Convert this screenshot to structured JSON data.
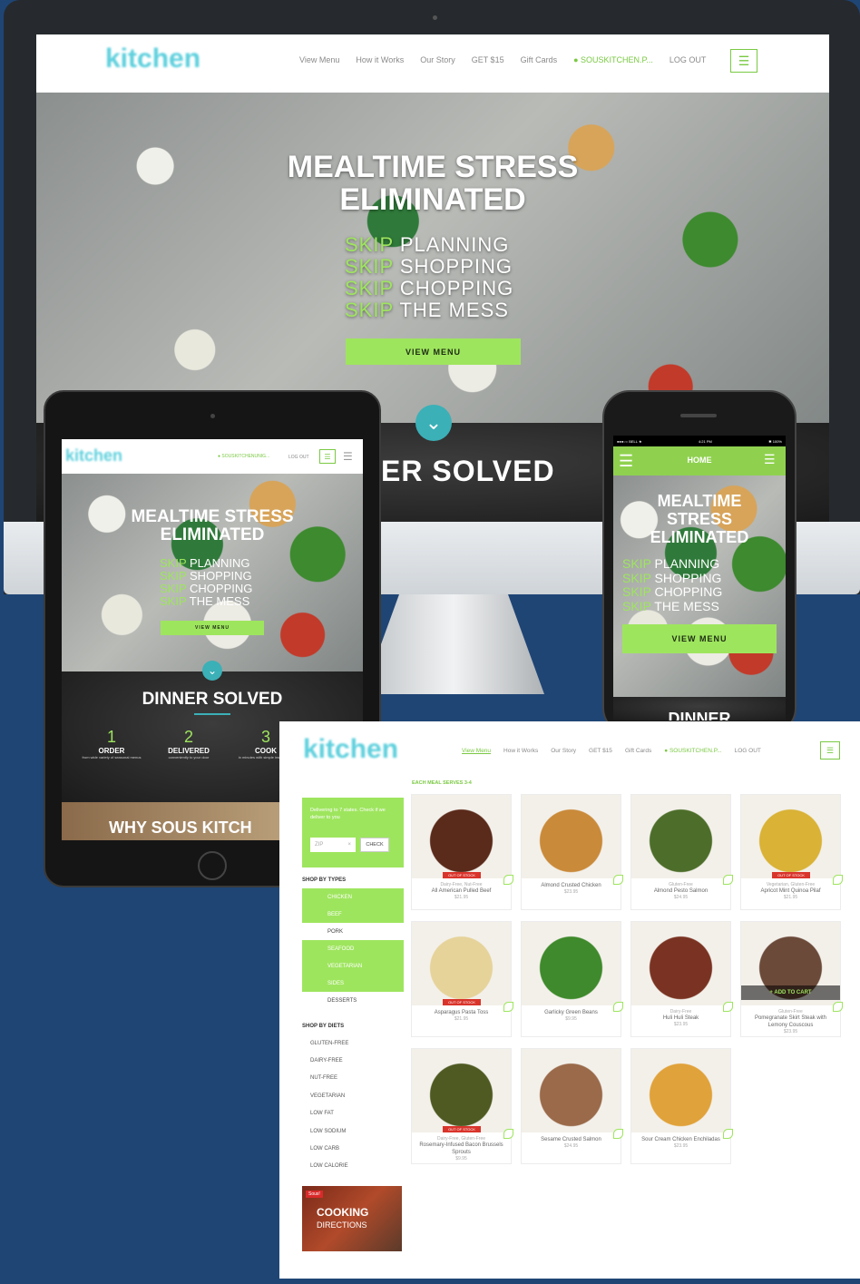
{
  "desktop": {
    "nav": [
      "View Menu",
      "How it Works",
      "Our Story",
      "GET $15",
      "Gift Cards"
    ],
    "user": "SOUSKITCHEN.P...",
    "logout": "LOG OUT",
    "hero": {
      "title1": "MEALTIME STRESS",
      "title2": "ELIMINATED",
      "lines": [
        {
          "skip": "SKIP",
          "rest": "PLANNING"
        },
        {
          "skip": "SKIP",
          "rest": "SHOPPING"
        },
        {
          "skip": "SKIP",
          "rest": "CHOPPING"
        },
        {
          "skip": "SKIP",
          "rest": "THE  MESS"
        }
      ],
      "cta": "VIEW MENU"
    },
    "section": "ER SOLVED"
  },
  "tablet": {
    "user": "SOUSKITCHENUNIG...",
    "logout": "LOG OUT",
    "title1": "MEALTIME STRESS",
    "title2": "ELIMINATED",
    "lines": [
      {
        "skip": "SKIP",
        "rest": "PLANNING"
      },
      {
        "skip": "SKIP",
        "rest": "SHOPPING"
      },
      {
        "skip": "SKIP",
        "rest": "CHOPPING"
      },
      {
        "skip": "SKIP",
        "rest": "THE  MESS"
      }
    ],
    "cta": "VIEW MENU",
    "section": "DINNER SOLVED",
    "steps": [
      {
        "n": "1",
        "label": "ORDER",
        "desc": "from wide variety of seasonal menus"
      },
      {
        "n": "2",
        "label": "DELIVERED",
        "desc": "conveniently to your door"
      },
      {
        "n": "3",
        "label": "COOK",
        "desc": "in minutes with simple instructions"
      }
    ],
    "why": "WHY SOUS KITCH"
  },
  "phone": {
    "status": {
      "carrier": "●●●○○ BELL ★",
      "time": "4:21 PM",
      "battery": "✱ 100%"
    },
    "home": "HOME",
    "title1": "MEALTIME",
    "title2": "STRESS",
    "title3": "ELIMINATED",
    "lines": [
      {
        "skip": "SKIP",
        "rest": "PLANNING"
      },
      {
        "skip": "SKIP",
        "rest": "SHOPPING"
      },
      {
        "skip": "SKIP",
        "rest": "CHOPPING"
      },
      {
        "skip": "SKIP",
        "rest": "THE  MESS"
      }
    ],
    "cta": "VIEW MENU",
    "section": "DINNER"
  },
  "menu_page": {
    "nav": [
      "View Menu",
      "How it Works",
      "Our Story",
      "GET $15",
      "Gift Cards"
    ],
    "user": "SOUSKITCHEN.P...",
    "logout": "LOG OUT",
    "serves": "EACH MEAL SERVES 3-4",
    "deliver": "Delivering to 7 states. Check if we deliver to you",
    "zip_placeholder": "ZIP",
    "clear": "×",
    "check": "CHECK",
    "shop_types": "SHOP BY TYPES",
    "types": [
      {
        "label": "CHICKEN",
        "active": true
      },
      {
        "label": "BEEF",
        "active": true
      },
      {
        "label": "PORK",
        "active": false
      },
      {
        "label": "SEAFOOD",
        "active": true
      },
      {
        "label": "VEGETARIAN",
        "active": true
      },
      {
        "label": "SIDES",
        "active": true
      },
      {
        "label": "DESSERTS",
        "active": false
      }
    ],
    "shop_diets": "SHOP BY DIETS",
    "diets": [
      "GLUTEN-FREE",
      "DAIRY-FREE",
      "NUT-FREE",
      "VEGETARIAN",
      "LOW FAT",
      "LOW SODIUM",
      "LOW CARB",
      "LOW CALORIE"
    ],
    "promo_tag": "Sous!",
    "promo1": "COOKING",
    "promo2": "DIRECTIONS",
    "out_of_stock": "OUT OF STOCK",
    "add_to_cart": "+ ADD TO CART",
    "meals": [
      {
        "tags": "Dairy-Free, Nut-Free",
        "name": "All American Pulled Beef",
        "price": "$21.95",
        "oos": true,
        "color": "#5a2a1a"
      },
      {
        "tags": "",
        "name": "Almond Crusted Chicken",
        "price": "$23.95",
        "oos": false,
        "color": "#c98a3a"
      },
      {
        "tags": "Gluten-Free",
        "name": "Almond Pesto Salmon",
        "price": "$24.95",
        "oos": false,
        "color": "#4d6e2a"
      },
      {
        "tags": "Vegetarian, Gluten-Free",
        "name": "Apricot Mint Quinoa Pilaf",
        "price": "$21.95",
        "oos": true,
        "color": "#d9b236"
      },
      {
        "tags": "",
        "name": "Asparagus Pasta Toss",
        "price": "$21.95",
        "oos": true,
        "color": "#e6d39a"
      },
      {
        "tags": "",
        "name": "Garlicky Green Beans",
        "price": "$9.95",
        "oos": false,
        "color": "#3f8a2c"
      },
      {
        "tags": "Dairy-Free",
        "name": "Huli Huli Steak",
        "price": "$23.95",
        "oos": false,
        "color": "#7a3322"
      },
      {
        "tags": "Gluten-Free",
        "name": "Pomegranate Skirt Steak with Lemony Couscous",
        "price": "$23.95",
        "oos": false,
        "color": "#6b4a3a",
        "cart": true
      },
      {
        "tags": "Dairy-Free, Gluten-Free",
        "name": "Rosemary-Infused Bacon Brussels Sprouts",
        "price": "$9.95",
        "oos": true,
        "color": "#4e5a22"
      },
      {
        "tags": "",
        "name": "Sesame Crusted Salmon",
        "price": "$24.95",
        "oos": false,
        "color": "#9a6a4a"
      },
      {
        "tags": "",
        "name": "Sour Cream Chicken Enchiladas",
        "price": "$23.95",
        "oos": false,
        "color": "#e0a23a"
      }
    ]
  }
}
